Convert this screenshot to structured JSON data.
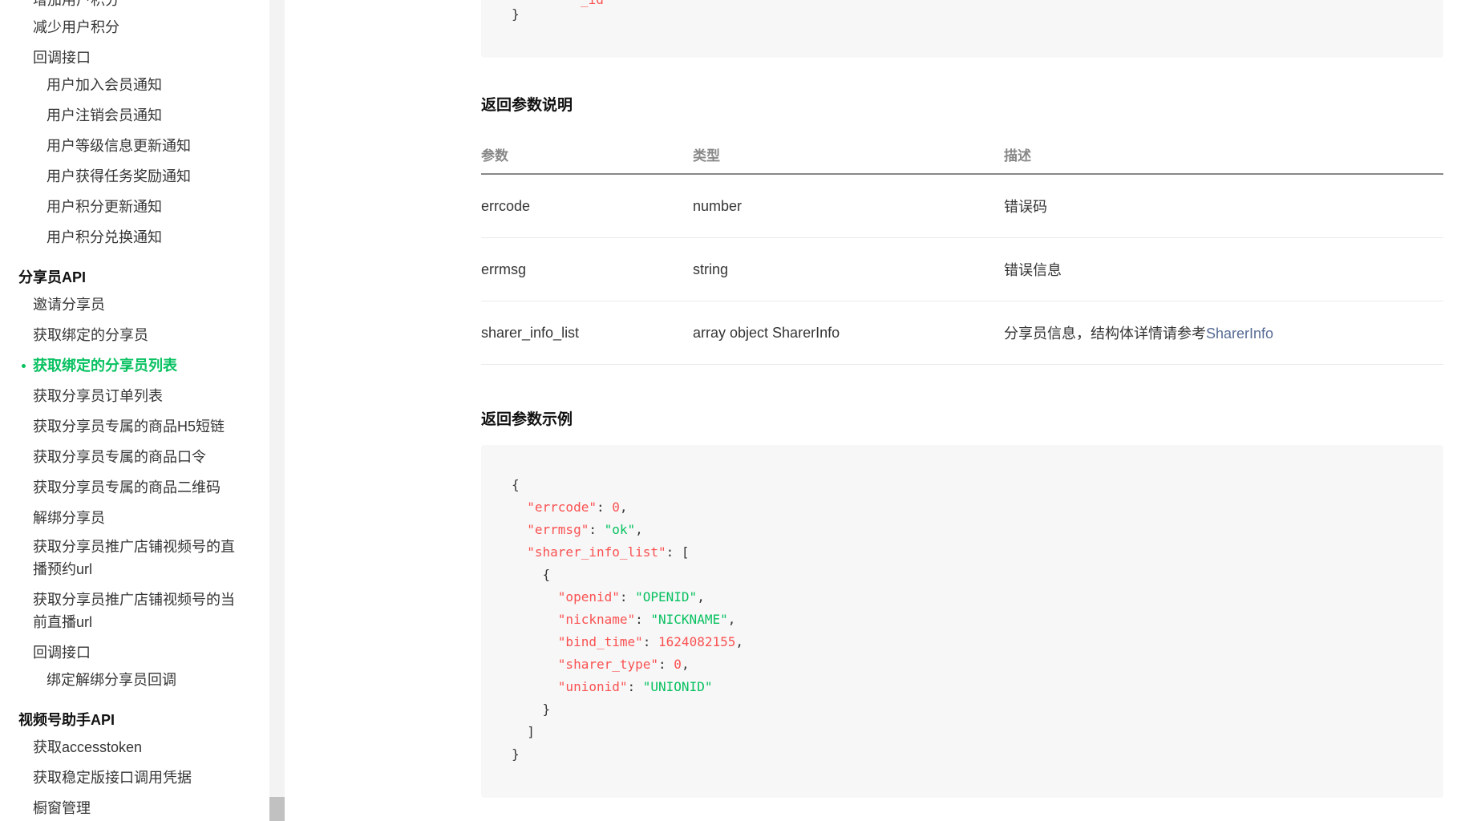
{
  "sidebar": {
    "items_top": [
      {
        "label": "增加用户积分",
        "level": 1
      },
      {
        "label": "减少用户积分",
        "level": 1
      },
      {
        "label": "回调接口",
        "level": 1
      },
      {
        "label": "用户加入会员通知",
        "level": 2
      },
      {
        "label": "用户注销会员通知",
        "level": 2
      },
      {
        "label": "用户等级信息更新通知",
        "level": 2
      },
      {
        "label": "用户获得任务奖励通知",
        "level": 2
      },
      {
        "label": "用户积分更新通知",
        "level": 2
      },
      {
        "label": "用户积分兑换通知",
        "level": 2
      }
    ],
    "section_sharer": "分享员API",
    "sharer_items": [
      "邀请分享员",
      "获取绑定的分享员",
      "获取绑定的分享员列表",
      "获取分享员订单列表",
      "获取分享员专属的商品H5短链",
      "获取分享员专属的商品口令",
      "获取分享员专属的商品二维码",
      "解绑分享员",
      "获取分享员推广店铺视频号的直播预约url",
      "获取分享员推广店铺视频号的当前直播url",
      "回调接口",
      "绑定解绑分享员回调"
    ],
    "section_assistant": "视频号助手API",
    "assistant_items": [
      "获取accesstoken",
      "获取稳定版接口调用凭据",
      "橱窗管理"
    ]
  },
  "main": {
    "return_params_title": "返回参数说明",
    "table": {
      "headers": [
        "参数",
        "类型",
        "描述"
      ],
      "rows": [
        {
          "param": "errcode",
          "type": "number",
          "desc": "错误码"
        },
        {
          "param": "errmsg",
          "type": "string",
          "desc": "错误信息"
        },
        {
          "param": "sharer_info_list",
          "type": "array object SharerInfo",
          "desc": "分享员信息，结构体详情请参考",
          "link": "SharerInfo"
        }
      ]
    },
    "return_example_title": "返回参数示例",
    "code_top_closing": "}",
    "code_top_cut": "_id\"",
    "example": {
      "errcode_key": "\"errcode\"",
      "errcode_val": "0",
      "errmsg_key": "\"errmsg\"",
      "errmsg_val": "\"ok\"",
      "list_key": "\"sharer_info_list\"",
      "openid_key": "\"openid\"",
      "openid_val": "\"OPENID\"",
      "nickname_key": "\"nickname\"",
      "nickname_val": "\"NICKNAME\"",
      "bind_time_key": "\"bind_time\"",
      "bind_time_val": "1624082155",
      "sharer_type_key": "\"sharer_type\"",
      "sharer_type_val": "0",
      "unionid_key": "\"unionid\"",
      "unionid_val": "\"UNIONID\""
    }
  }
}
